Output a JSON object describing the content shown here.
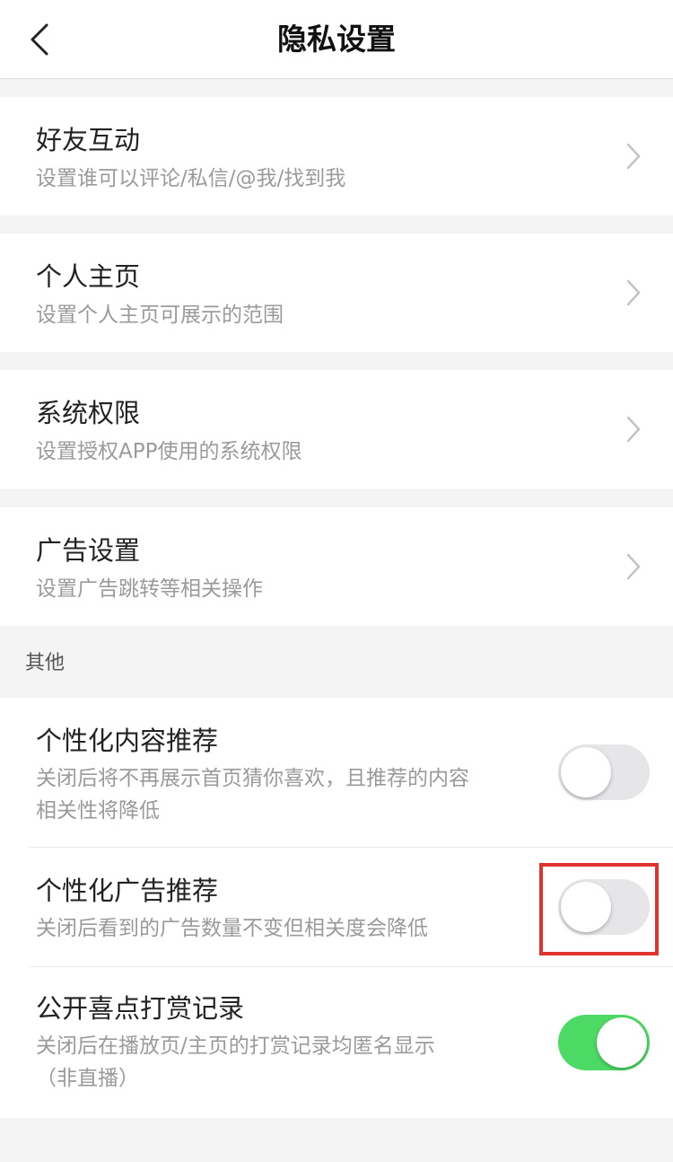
{
  "header": {
    "title": "隐私设置",
    "back_icon": "chevron-left-icon"
  },
  "menu": [
    {
      "title": "好友互动",
      "subtitle": "设置谁可以评论/私信/@我/找到我"
    },
    {
      "title": "个人主页",
      "subtitle": "设置个人主页可展示的范围"
    },
    {
      "title": "系统权限",
      "subtitle": "设置授权APP使用的系统权限"
    },
    {
      "title": "广告设置",
      "subtitle": "设置广告跳转等相关操作"
    }
  ],
  "other": {
    "label": "其他",
    "items": [
      {
        "title": "个性化内容推荐",
        "subtitle_line1": "关闭后将不再展示首页猜你喜欢，且推荐的内容",
        "subtitle_line2": "相关性将降低",
        "enabled": false
      },
      {
        "title": "个性化广告推荐",
        "subtitle_line1": "关闭后看到的广告数量不变但相关度会降低",
        "enabled": false
      },
      {
        "title": "公开喜点打赏记录",
        "subtitle_line1": "关闭后在播放页/主页的打赏记录均匿名显示",
        "subtitle_line2": "（非直播）",
        "enabled": true
      }
    ]
  },
  "colors": {
    "toggle_on": "#4cd964",
    "toggle_off": "#e6e6e9",
    "highlight": "#e0332b"
  }
}
